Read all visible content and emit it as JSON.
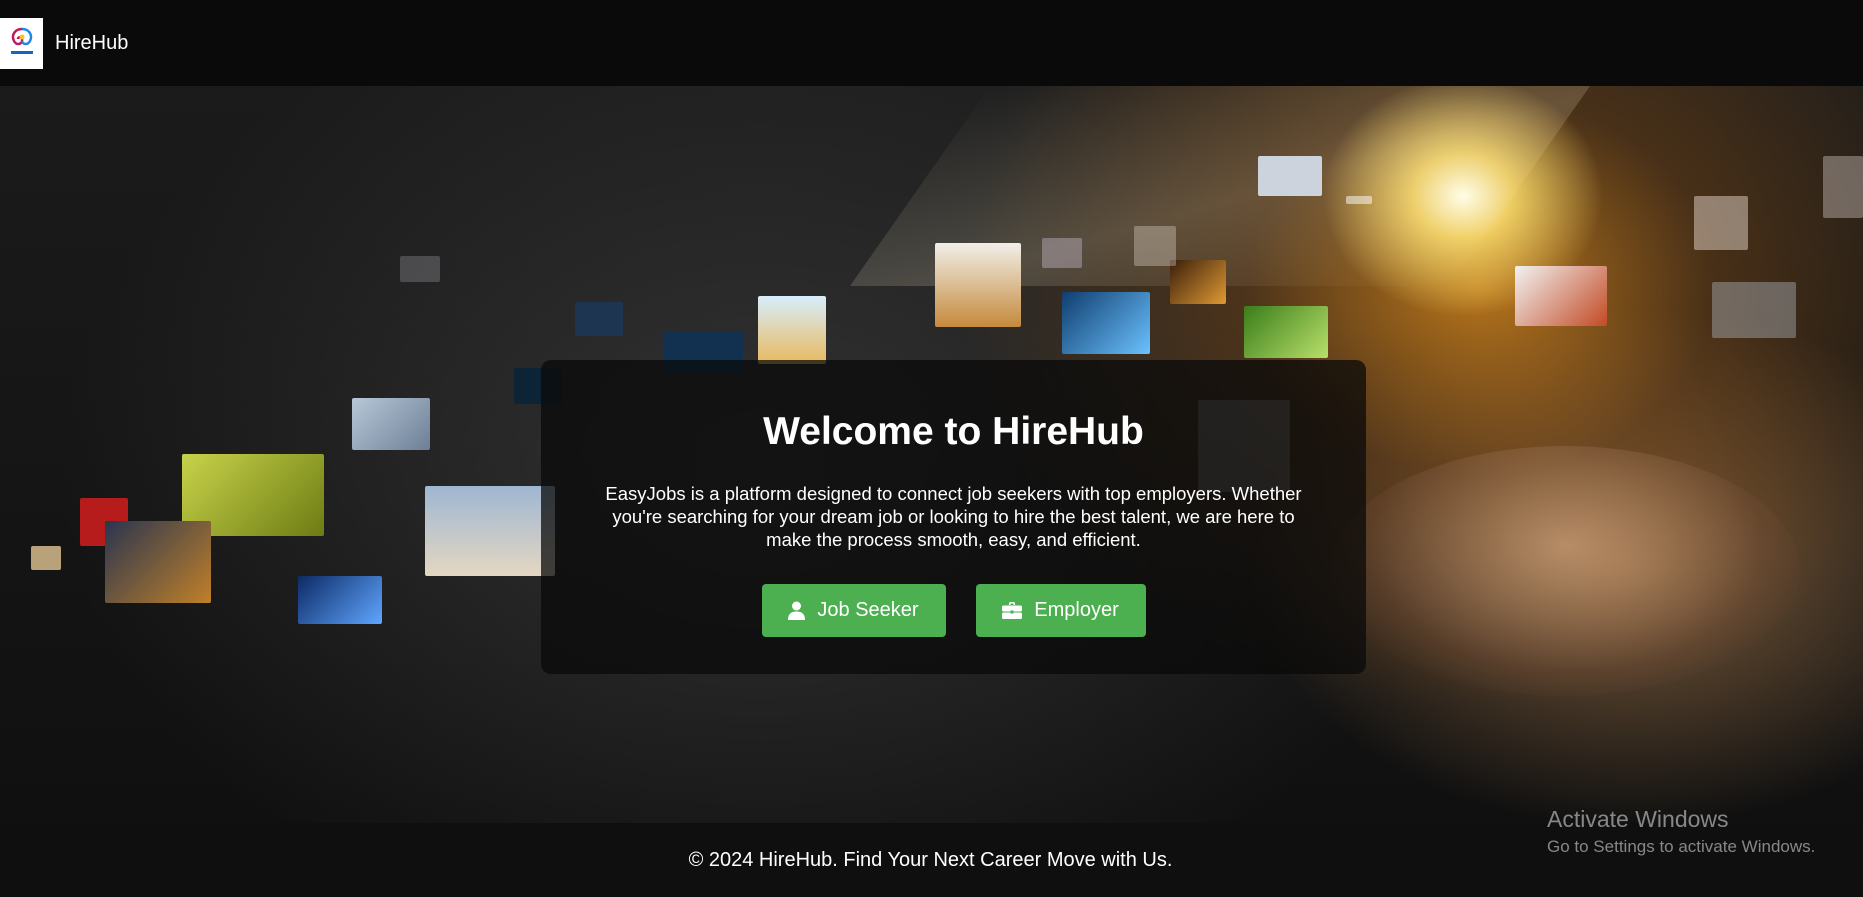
{
  "app": {
    "brand": "HireHub"
  },
  "hero": {
    "title": "Welcome to HireHub",
    "description": "EasyJobs is a platform designed to connect job seekers with top employers. Whether you're searching for your dream job or looking to hire the best talent, we are here to make the process smooth, easy, and efficient.",
    "buttons": {
      "job_seeker": {
        "label": "Job Seeker",
        "icon": "user-icon"
      },
      "employer": {
        "label": "Employer",
        "icon": "briefcase-icon"
      }
    }
  },
  "footer": {
    "text": "© 2024 HireHub. Find Your Next Career Move with Us."
  },
  "watermark": {
    "title": "Activate Windows",
    "subtitle": "Go to Settings to activate Windows."
  },
  "colors": {
    "accent": "#4caf50",
    "navbar": "#0a0a0a",
    "card": "rgba(10,10,10,0.75)"
  }
}
